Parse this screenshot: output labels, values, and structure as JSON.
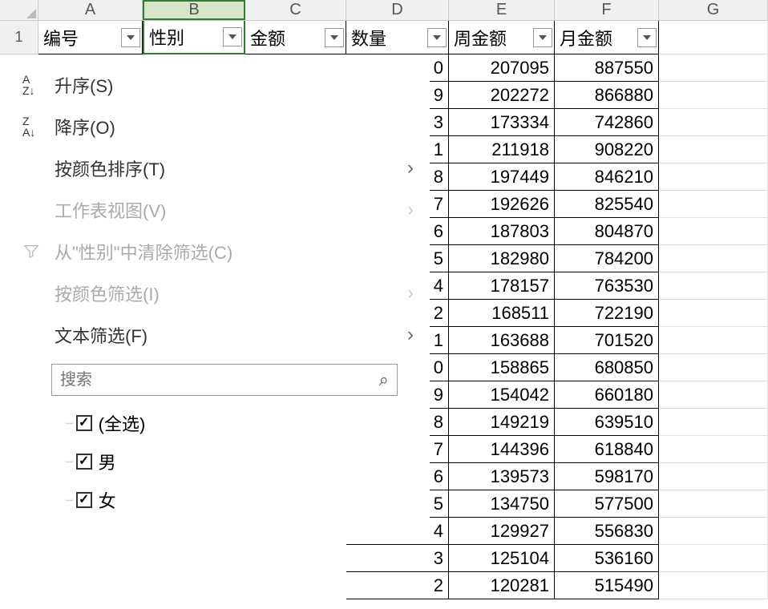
{
  "columns": [
    "A",
    "B",
    "C",
    "D",
    "E",
    "F",
    "G"
  ],
  "selectedColumn": "B",
  "rowHeaderFirst": "1",
  "headerRow": {
    "A": "编号",
    "B": "性别",
    "C": "金额",
    "D": "数量",
    "E": "周金额",
    "F": "月金额"
  },
  "dataRows": [
    {
      "D": "0",
      "E": "207095",
      "F": "887550"
    },
    {
      "D": "9",
      "E": "202272",
      "F": "866880"
    },
    {
      "D": "3",
      "E": "173334",
      "F": "742860"
    },
    {
      "D": "1",
      "E": "211918",
      "F": "908220"
    },
    {
      "D": "8",
      "E": "197449",
      "F": "846210"
    },
    {
      "D": "7",
      "E": "192626",
      "F": "825540"
    },
    {
      "D": "6",
      "E": "187803",
      "F": "804870"
    },
    {
      "D": "5",
      "E": "182980",
      "F": "784200"
    },
    {
      "D": "4",
      "E": "178157",
      "F": "763530"
    },
    {
      "D": "2",
      "E": "168511",
      "F": "722190"
    },
    {
      "D": "1",
      "E": "163688",
      "F": "701520"
    },
    {
      "D": "0",
      "E": "158865",
      "F": "680850"
    },
    {
      "D": "9",
      "E": "154042",
      "F": "660180"
    },
    {
      "D": "8",
      "E": "149219",
      "F": "639510"
    },
    {
      "D": "7",
      "E": "144396",
      "F": "618840"
    },
    {
      "D": "6",
      "E": "139573",
      "F": "598170"
    },
    {
      "D": "5",
      "E": "134750",
      "F": "577500"
    },
    {
      "D": "4",
      "E": "129927",
      "F": "556830"
    },
    {
      "D": "3",
      "E": "125104",
      "F": "536160"
    },
    {
      "D": "2",
      "E": "120281",
      "F": "515490"
    }
  ],
  "filterMenu": {
    "sortAsc": "升序(S)",
    "sortDesc": "降序(O)",
    "sortByColor": "按颜色排序(T)",
    "sheetView": "工作表视图(V)",
    "clearFilter": "从\"性别\"中清除筛选(C)",
    "filterByColor": "按颜色筛选(I)",
    "textFilter": "文本筛选(F)",
    "searchPlaceholder": "搜索",
    "selectAll": "(全选)",
    "options": [
      "男",
      "女"
    ]
  }
}
